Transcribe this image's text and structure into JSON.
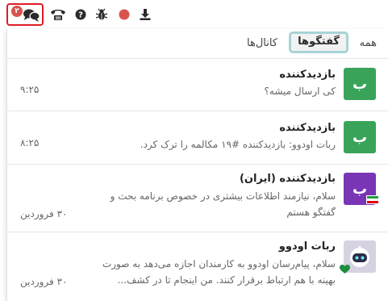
{
  "topbar": {
    "chat_badge": "۲",
    "icons": [
      "chat-bubbles-icon",
      "phone-icon",
      "help-icon",
      "bug-icon",
      "record-icon",
      "download-icon"
    ],
    "colors": {
      "badge": "#d9534f",
      "highlight_border": "#e01b24",
      "record": "#d9534f"
    }
  },
  "tabs": {
    "all": "همه",
    "chats": "گفتگوها",
    "channels": "کانال‌ها",
    "active": "chats"
  },
  "threads": [
    {
      "avatar_letter": "ب",
      "avatar_color": "#3aa35a",
      "title": "بازدیدکننده",
      "message": "کی ارسال میشه؟",
      "date": "۹:۲۵"
    },
    {
      "avatar_letter": "ب",
      "avatar_color": "#3aa35a",
      "title": "بازدیدکننده",
      "message": "ربات اودوو: بازدیدکننده #۱۹ مکالمه را ترک کرد.",
      "date": "۸:۲۵"
    },
    {
      "avatar_letter": "ب",
      "avatar_color": "#7a35b5",
      "title": "بازدیدکننده (ایران)",
      "message_line1": "سلام، نیازمند اطلاعات بیشتری در خصوص برنامه بحث و",
      "message_line2": "گفتگو هستم",
      "date": "۳۰ فروردین",
      "flag": "iran-flag-icon"
    },
    {
      "avatar_icon": "robot-avatar-icon",
      "title": "ربات اودوو",
      "message_line1": "سلام، پیام‌رسان اودوو به کارمندان اجازه می‌دهد به صورت",
      "message_line2": "بهینه با هم ارتباط برقرار کنند. من اینجام تا در کشف...",
      "date": "۳۰ فروردین",
      "status": "heart-icon"
    }
  ]
}
